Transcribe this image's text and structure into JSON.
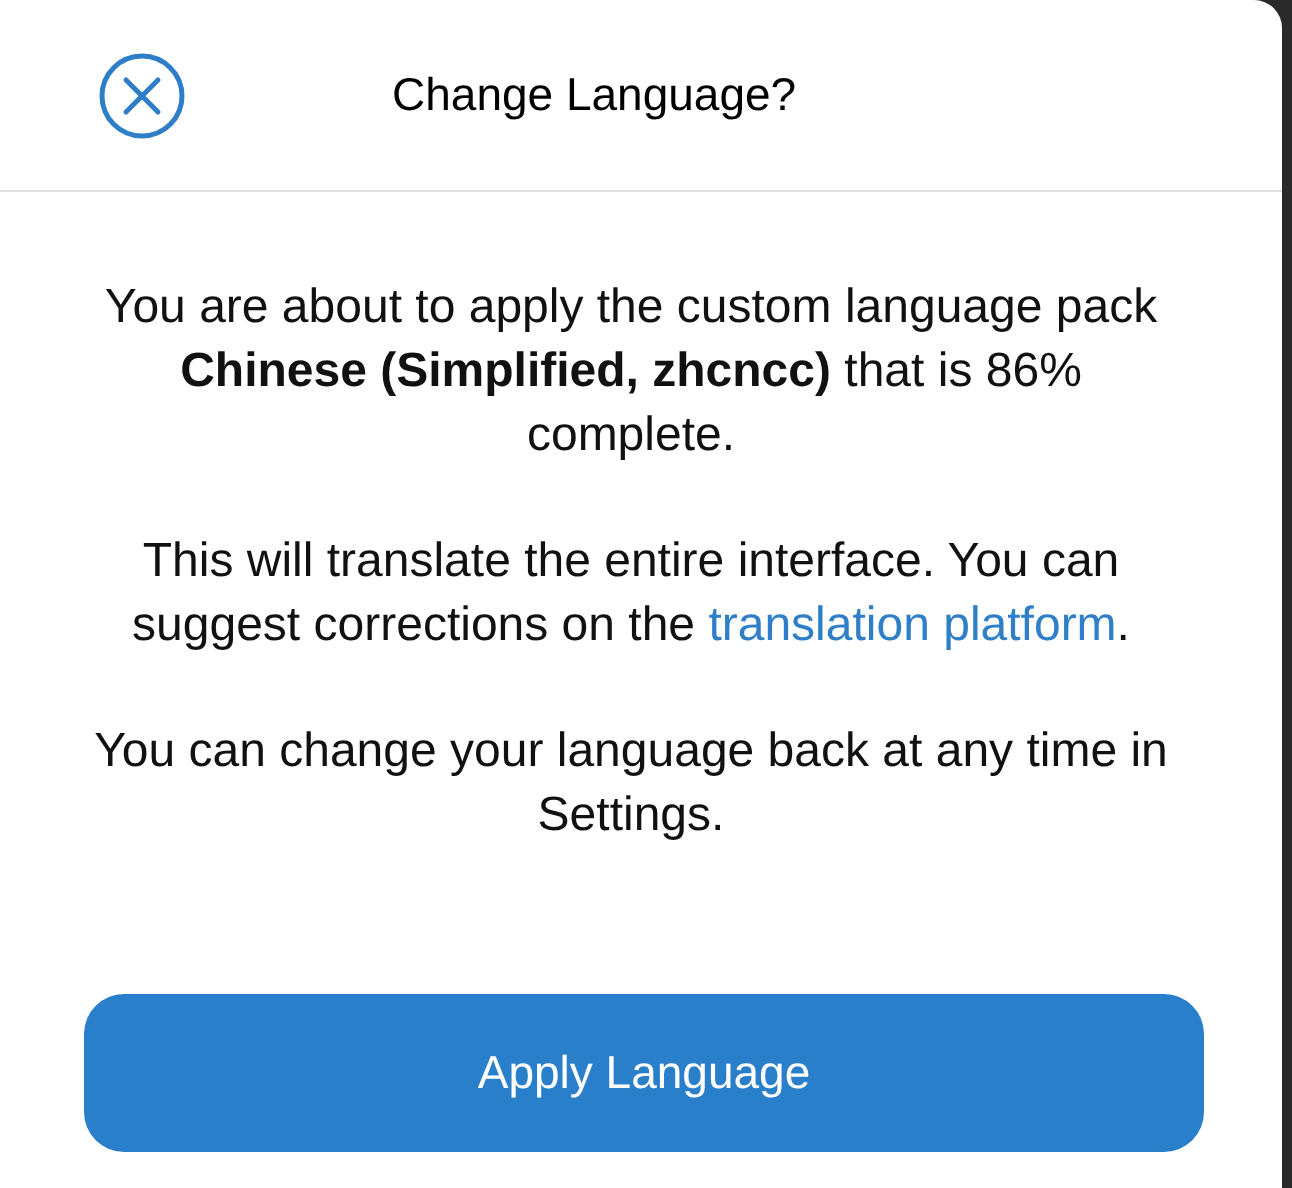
{
  "dialog": {
    "title": "Change Language?",
    "paragraphs": [
      {
        "text": "You are about to apply the custom language pack **Chinese (Simplified, zhcncc)** that is 86% complete."
      },
      {
        "text": "This will translate the entire interface. You can suggest corrections on the",
        "link": "translation platform",
        "after": "."
      },
      {
        "text": "You can change your language back at any time in Settings."
      }
    ],
    "button": "Apply Language"
  }
}
